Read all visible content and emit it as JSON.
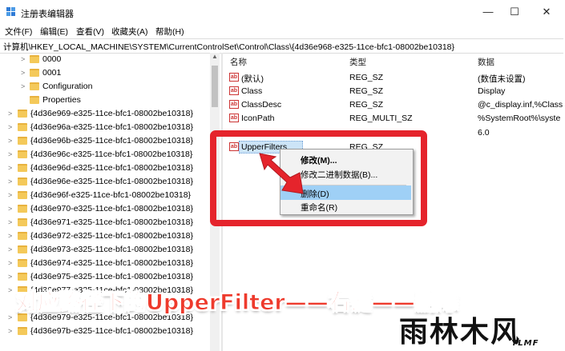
{
  "window": {
    "title": "注册表编辑器",
    "controls": [
      "—",
      "☐",
      "✕"
    ]
  },
  "menu": [
    "文件(F)",
    "编辑(E)",
    "查看(V)",
    "收藏夹(A)",
    "帮助(H)"
  ],
  "address": "计算机\\HKEY_LOCAL_MACHINE\\SYSTEM\\CurrentControlSet\\Control\\Class\\{4d36e968-e325-11ce-bfc1-08002be10318}",
  "tree": {
    "children": [
      "0000",
      "0001",
      "Configuration",
      "Properties"
    ],
    "keys": [
      "{4d36e969-e325-11ce-bfc1-08002be10318}",
      "{4d36e96a-e325-11ce-bfc1-08002be10318}",
      "{4d36e96b-e325-11ce-bfc1-08002be10318}",
      "{4d36e96c-e325-11ce-bfc1-08002be10318}",
      "{4d36e96d-e325-11ce-bfc1-08002be10318}",
      "{4d36e96e-e325-11ce-bfc1-08002be10318}",
      "{4d36e96f-e325-11ce-bfc1-08002be10318}",
      "{4d36e970-e325-11ce-bfc1-08002be10318}",
      "{4d36e971-e325-11ce-bfc1-08002be10318}",
      "{4d36e972-e325-11ce-bfc1-08002be10318}",
      "{4d36e973-e325-11ce-bfc1-08002be10318}",
      "{4d36e974-e325-11ce-bfc1-08002be10318}",
      "{4d36e975-e325-11ce-bfc1-08002be10318}",
      "{4d36e977-e325-11ce-bfc1-08002be10318}",
      "{4d36e979-e325-11ce-bfc1-08002be10318}",
      "{4d36e97b-e325-11ce-bfc1-08002be10318}"
    ]
  },
  "values": {
    "headers": {
      "name": "名称",
      "type": "类型",
      "data": "数据"
    },
    "rows": [
      {
        "icon": "ab",
        "name": "(默认)",
        "type": "REG_SZ",
        "data": "(数值未设置)"
      },
      {
        "icon": "ab",
        "name": "Class",
        "type": "REG_SZ",
        "data": "Display"
      },
      {
        "icon": "ab",
        "name": "ClassDesc",
        "type": "REG_SZ",
        "data": "@c_display.inf,%Class"
      },
      {
        "icon": "ab",
        "name": "IconPath",
        "type": "REG_MULTI_SZ",
        "data": "%SystemRoot%\\syste"
      },
      {
        "icon": "ab",
        "name": "",
        "type": "",
        "data": "6.0"
      },
      {
        "icon": "ab",
        "name": "UpperFilters",
        "type": "REG_SZ",
        "data": ""
      }
    ]
  },
  "context_menu": [
    {
      "label": "修改(M)...",
      "bold": true
    },
    {
      "label": "修改二进制数据(B)...",
      "bold": false
    },
    {
      "label": "删除(D)",
      "bold": false,
      "highlighted": true
    },
    {
      "label": "重命名(R)",
      "bold": false
    }
  ],
  "banner": "对应路径下的UpperFilter——右键——删除",
  "logo": {
    "main": "雨林木风",
    "sub": "YLMF"
  },
  "colors": {
    "highlight": "#e5242c",
    "menu_selected": "#9fd0f6",
    "folder": "#f4c95a"
  }
}
